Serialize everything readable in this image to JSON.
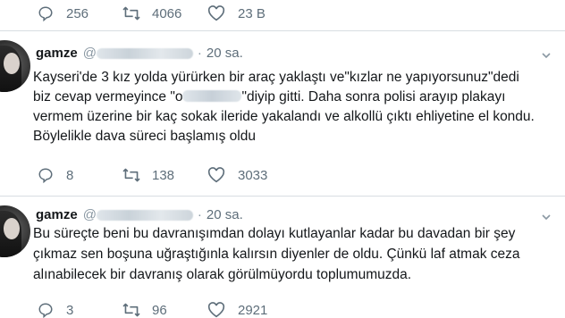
{
  "top_actions": {
    "reply_count": "256",
    "retweet_count": "4066",
    "like_count": "23 B"
  },
  "tweets": [
    {
      "name": "gamze",
      "time": "20 sa.",
      "lines": [
        "Kayseri'de 3 kız yolda yürürken bir araç yaklaştı ve\"kızlar ne yapıyorsunuz\"dedi",
        "biz cevap vermeyince \"o",
        "\"diyip gitti. Daha sonra polisi arayıp plakayı",
        "vermem üzerine bir kaç sokak ileride yakalandı ve alkollü çıktı ehliyetine el kondu.",
        "Böylelikle dava süreci başlamış oldu"
      ],
      "reply_count": "8",
      "retweet_count": "138",
      "like_count": "3033"
    },
    {
      "name": "gamze",
      "time": "20 sa.",
      "lines": [
        "Bu süreçte beni bu davranışımdan dolayı kutlayanlar kadar bu davadan bir şey",
        "çıkmaz sen boşuna uğraştığınla kalırsın diyenler de oldu. Çünkü laf atmak ceza",
        "alınabilecek bir davranış olarak görülmüyordu toplumumuzda."
      ],
      "reply_count": "3",
      "retweet_count": "96",
      "like_count": "2921"
    }
  ],
  "icons": {
    "reply": "reply-icon",
    "retweet": "retweet-icon",
    "like": "heart-icon",
    "caret": "chevron-down-icon"
  },
  "colors": {
    "text": "#14171a",
    "muted": "#5e6e7a",
    "divider": "#d8dde2"
  }
}
